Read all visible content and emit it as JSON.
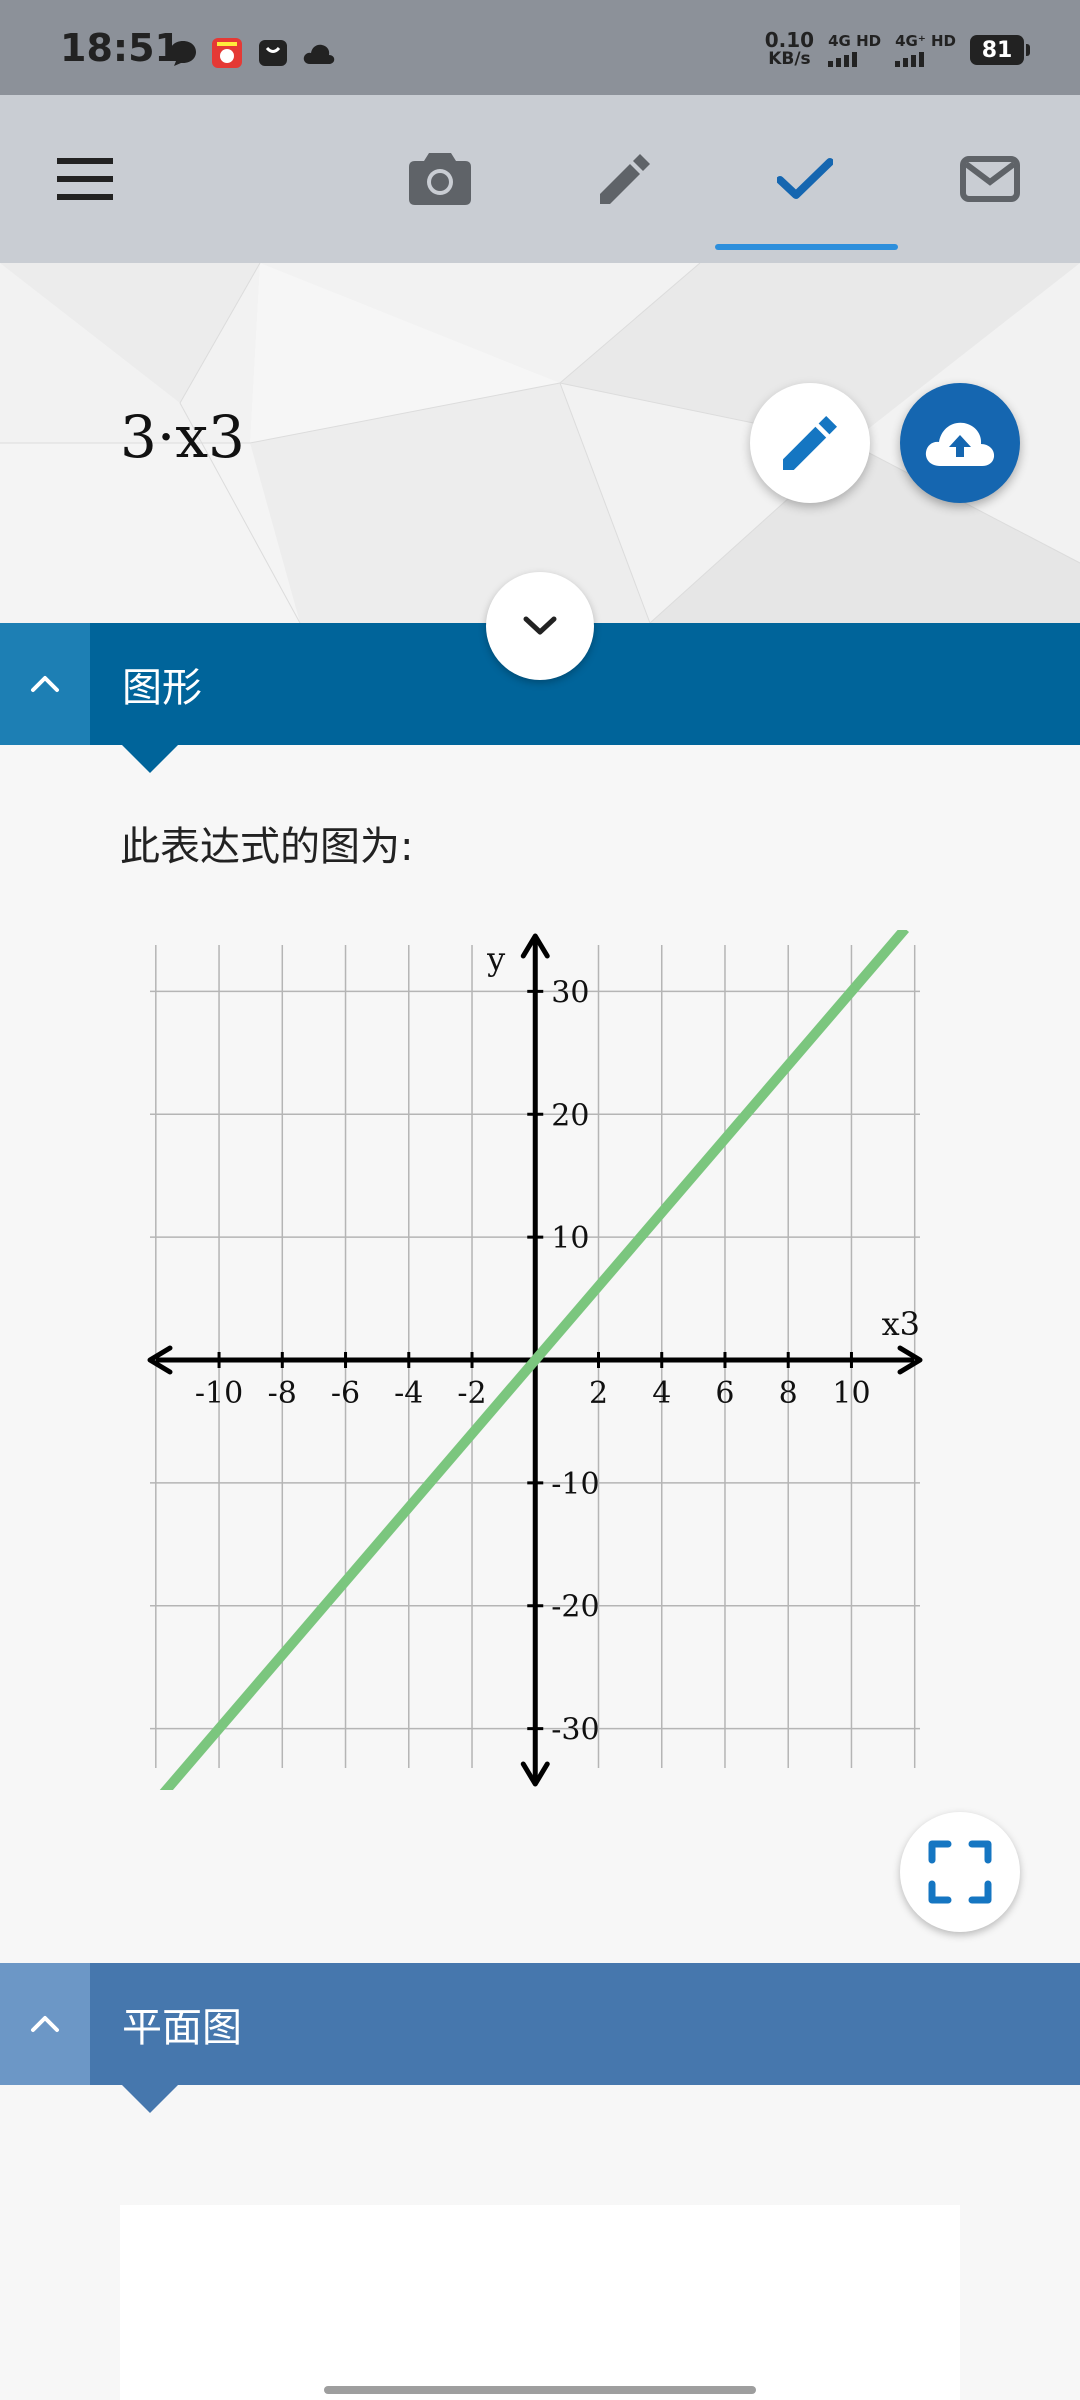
{
  "status_bar": {
    "time": "18:51",
    "net_speed_value": "0.10",
    "net_speed_unit": "KB/s",
    "net_type_1": "4G HD",
    "net_type_2": "4G⁺ HD",
    "battery": "81"
  },
  "toolbar": {
    "icons": [
      "menu-icon",
      "camera-icon",
      "pencil-icon",
      "check-icon",
      "mail-icon"
    ],
    "active_tab": "check",
    "accent_color": "#2d8fdc"
  },
  "expression": {
    "text": "3·x3"
  },
  "sections": {
    "graph": {
      "title": "图形",
      "caption": "此表达式的图为:"
    },
    "plane": {
      "title": "平面图"
    }
  },
  "chart_data": {
    "type": "line",
    "xlabel": "x3",
    "ylabel": "y",
    "xlim": [
      -12.5,
      12.8
    ],
    "ylim": [
      -35,
      35
    ],
    "x_ticks": [
      -10,
      -8,
      -6,
      -4,
      -2,
      2,
      4,
      6,
      8,
      10
    ],
    "y_ticks": [
      -30,
      -20,
      -10,
      10,
      20,
      30
    ],
    "grid": true,
    "series": [
      {
        "x": [
          -12.4,
          11.7
        ],
        "y": [
          -37.2,
          35.1
        ],
        "color": "#7bc67e"
      }
    ]
  }
}
